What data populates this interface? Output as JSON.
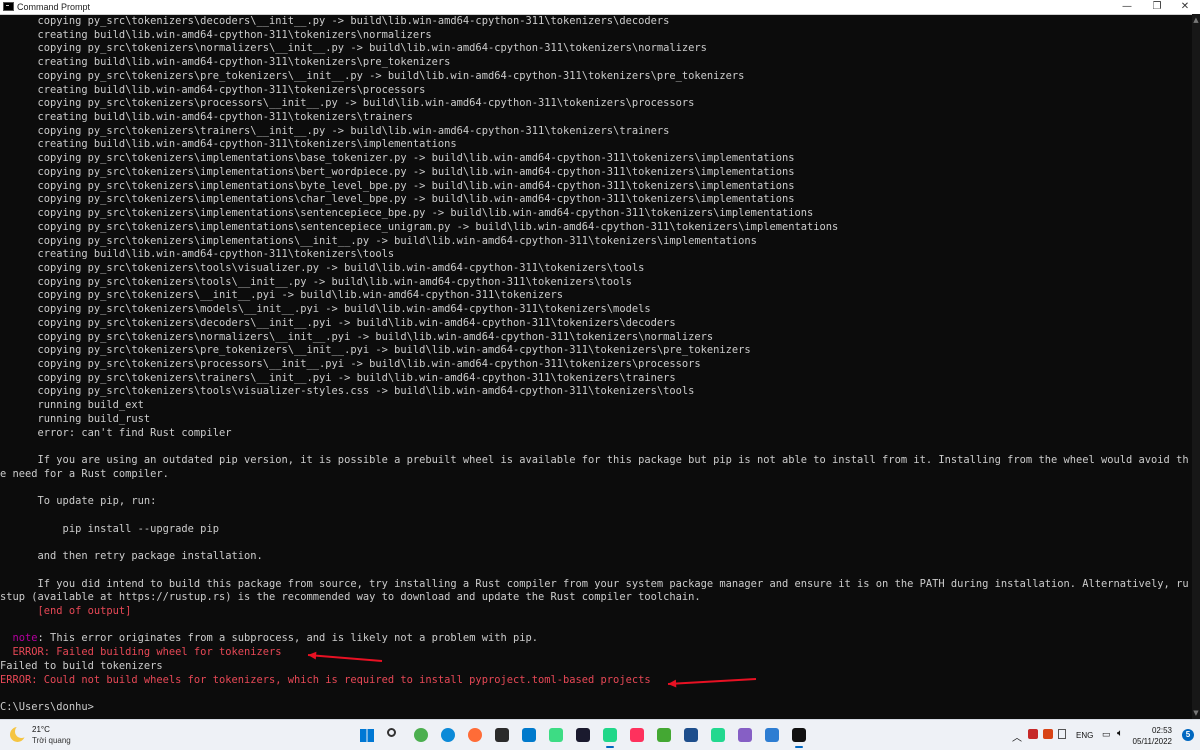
{
  "window": {
    "title": "Command Prompt",
    "minimize_glyph": "—",
    "maximize_glyph": "❐",
    "close_glyph": "✕"
  },
  "console_lines": [
    {
      "text": "      copying py_src\\tokenizers\\decoders\\__init__.py -> build\\lib.win-amd64-cpython-311\\tokenizers\\decoders",
      "color": "default"
    },
    {
      "text": "      creating build\\lib.win-amd64-cpython-311\\tokenizers\\normalizers",
      "color": "default"
    },
    {
      "text": "      copying py_src\\tokenizers\\normalizers\\__init__.py -> build\\lib.win-amd64-cpython-311\\tokenizers\\normalizers",
      "color": "default"
    },
    {
      "text": "      creating build\\lib.win-amd64-cpython-311\\tokenizers\\pre_tokenizers",
      "color": "default"
    },
    {
      "text": "      copying py_src\\tokenizers\\pre_tokenizers\\__init__.py -> build\\lib.win-amd64-cpython-311\\tokenizers\\pre_tokenizers",
      "color": "default"
    },
    {
      "text": "      creating build\\lib.win-amd64-cpython-311\\tokenizers\\processors",
      "color": "default"
    },
    {
      "text": "      copying py_src\\tokenizers\\processors\\__init__.py -> build\\lib.win-amd64-cpython-311\\tokenizers\\processors",
      "color": "default"
    },
    {
      "text": "      creating build\\lib.win-amd64-cpython-311\\tokenizers\\trainers",
      "color": "default"
    },
    {
      "text": "      copying py_src\\tokenizers\\trainers\\__init__.py -> build\\lib.win-amd64-cpython-311\\tokenizers\\trainers",
      "color": "default"
    },
    {
      "text": "      creating build\\lib.win-amd64-cpython-311\\tokenizers\\implementations",
      "color": "default"
    },
    {
      "text": "      copying py_src\\tokenizers\\implementations\\base_tokenizer.py -> build\\lib.win-amd64-cpython-311\\tokenizers\\implementations",
      "color": "default"
    },
    {
      "text": "      copying py_src\\tokenizers\\implementations\\bert_wordpiece.py -> build\\lib.win-amd64-cpython-311\\tokenizers\\implementations",
      "color": "default"
    },
    {
      "text": "      copying py_src\\tokenizers\\implementations\\byte_level_bpe.py -> build\\lib.win-amd64-cpython-311\\tokenizers\\implementations",
      "color": "default"
    },
    {
      "text": "      copying py_src\\tokenizers\\implementations\\char_level_bpe.py -> build\\lib.win-amd64-cpython-311\\tokenizers\\implementations",
      "color": "default"
    },
    {
      "text": "      copying py_src\\tokenizers\\implementations\\sentencepiece_bpe.py -> build\\lib.win-amd64-cpython-311\\tokenizers\\implementations",
      "color": "default"
    },
    {
      "text": "      copying py_src\\tokenizers\\implementations\\sentencepiece_unigram.py -> build\\lib.win-amd64-cpython-311\\tokenizers\\implementations",
      "color": "default"
    },
    {
      "text": "      copying py_src\\tokenizers\\implementations\\__init__.py -> build\\lib.win-amd64-cpython-311\\tokenizers\\implementations",
      "color": "default"
    },
    {
      "text": "      creating build\\lib.win-amd64-cpython-311\\tokenizers\\tools",
      "color": "default"
    },
    {
      "text": "      copying py_src\\tokenizers\\tools\\visualizer.py -> build\\lib.win-amd64-cpython-311\\tokenizers\\tools",
      "color": "default"
    },
    {
      "text": "      copying py_src\\tokenizers\\tools\\__init__.py -> build\\lib.win-amd64-cpython-311\\tokenizers\\tools",
      "color": "default"
    },
    {
      "text": "      copying py_src\\tokenizers\\__init__.pyi -> build\\lib.win-amd64-cpython-311\\tokenizers",
      "color": "default"
    },
    {
      "text": "      copying py_src\\tokenizers\\models\\__init__.pyi -> build\\lib.win-amd64-cpython-311\\tokenizers\\models",
      "color": "default"
    },
    {
      "text": "      copying py_src\\tokenizers\\decoders\\__init__.pyi -> build\\lib.win-amd64-cpython-311\\tokenizers\\decoders",
      "color": "default"
    },
    {
      "text": "      copying py_src\\tokenizers\\normalizers\\__init__.pyi -> build\\lib.win-amd64-cpython-311\\tokenizers\\normalizers",
      "color": "default"
    },
    {
      "text": "      copying py_src\\tokenizers\\pre_tokenizers\\__init__.pyi -> build\\lib.win-amd64-cpython-311\\tokenizers\\pre_tokenizers",
      "color": "default"
    },
    {
      "text": "      copying py_src\\tokenizers\\processors\\__init__.pyi -> build\\lib.win-amd64-cpython-311\\tokenizers\\processors",
      "color": "default"
    },
    {
      "text": "      copying py_src\\tokenizers\\trainers\\__init__.pyi -> build\\lib.win-amd64-cpython-311\\tokenizers\\trainers",
      "color": "default"
    },
    {
      "text": "      copying py_src\\tokenizers\\tools\\visualizer-styles.css -> build\\lib.win-amd64-cpython-311\\tokenizers\\tools",
      "color": "default"
    },
    {
      "text": "      running build_ext",
      "color": "default"
    },
    {
      "text": "      running build_rust",
      "color": "default"
    },
    {
      "text": "      error: can't find Rust compiler",
      "color": "default"
    },
    {
      "text": "",
      "color": "default"
    },
    {
      "text": "      If you are using an outdated pip version, it is possible a prebuilt wheel is available for this package but pip is not able to install from it. Installing from the wheel would avoid th",
      "color": "default"
    },
    {
      "text": "e need for a Rust compiler.",
      "color": "default"
    },
    {
      "text": "",
      "color": "default"
    },
    {
      "text": "      To update pip, run:",
      "color": "default"
    },
    {
      "text": "",
      "color": "default"
    },
    {
      "text": "          pip install --upgrade pip",
      "color": "default"
    },
    {
      "text": "",
      "color": "default"
    },
    {
      "text": "      and then retry package installation.",
      "color": "default"
    },
    {
      "text": "",
      "color": "default"
    },
    {
      "text": "      If you did intend to build this package from source, try installing a Rust compiler from your system package manager and ensure it is on the PATH during installation. Alternatively, ru",
      "color": "default"
    },
    {
      "text": "stup (available at https://rustup.rs) is the recommended way to download and update the Rust compiler toolchain.",
      "color": "default"
    },
    {
      "text": "      [end of output]",
      "color": "red"
    },
    {
      "text": "",
      "color": "default"
    },
    {
      "segments": [
        {
          "text": "  note",
          "color": "magenta"
        },
        {
          "text": ": This error originates from a subprocess, and is likely not a problem with pip.",
          "color": "default"
        }
      ]
    },
    {
      "text": "  ERROR: Failed building wheel for tokenizers",
      "color": "red"
    },
    {
      "text": "Failed to build tokenizers",
      "color": "default"
    },
    {
      "text": "ERROR: Could not build wheels for tokenizers, which is required to install pyproject.toml-based projects",
      "color": "red"
    },
    {
      "text": "",
      "color": "default"
    },
    {
      "text": "C:\\Users\\donhu>",
      "color": "default"
    }
  ],
  "annotations": {
    "arrow_color": "#e81123"
  },
  "taskbar": {
    "weather_temp": "21°C",
    "weather_condition": "Trời quang",
    "apps": [
      {
        "name": "start-icon",
        "color": "#0078d4"
      },
      {
        "name": "search-icon",
        "color": "#333333"
      },
      {
        "name": "chrome-icon",
        "color": "#4caf50"
      },
      {
        "name": "edge-icon",
        "color": "#0c8ad8"
      },
      {
        "name": "postman-icon",
        "color": "#ff6c37"
      },
      {
        "name": "terminal-icon",
        "color": "#2b2b2b"
      },
      {
        "name": "vscode-icon",
        "color": "#007acc"
      },
      {
        "name": "android-icon",
        "color": "#3ddc84"
      },
      {
        "name": "webstorm-icon",
        "color": "#1a1a2e"
      },
      {
        "name": "pycharm-icon",
        "color": "#21d789"
      },
      {
        "name": "intellij-icon",
        "color": "#fe315d"
      },
      {
        "name": "anaconda-icon",
        "color": "#44a833"
      },
      {
        "name": "git-icon",
        "color": "#1e4e8c"
      },
      {
        "name": "datagrip-icon",
        "color": "#22d88f"
      },
      {
        "name": "visualstudio-icon",
        "color": "#865fc5"
      },
      {
        "name": "notepad-icon",
        "color": "#2d7dd2"
      },
      {
        "name": "cmd-icon",
        "color": "#111111"
      }
    ],
    "lang": "ENG",
    "time": "02:53",
    "date": "05/11/2022",
    "notification_count": "5"
  }
}
